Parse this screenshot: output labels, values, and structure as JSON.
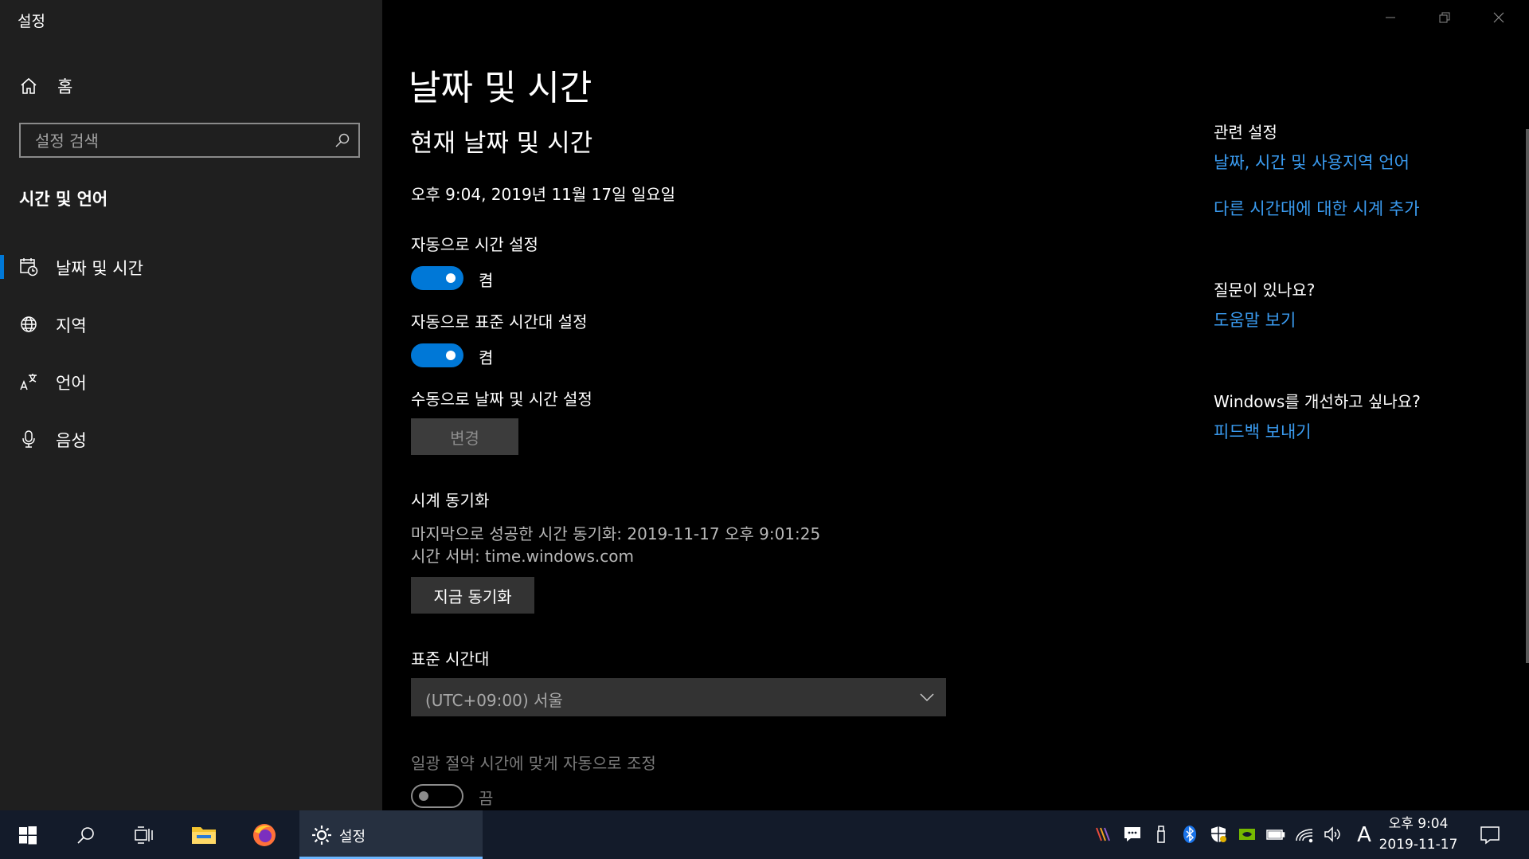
{
  "window": {
    "title": "설정"
  },
  "sidebar": {
    "home_label": "홈",
    "search_placeholder": "설정 검색",
    "section_header": "시간 및 언어",
    "items": [
      {
        "label": "날짜 및 시간",
        "icon": "calendar-clock-icon",
        "active": true
      },
      {
        "label": "지역",
        "icon": "globe-icon",
        "active": false
      },
      {
        "label": "언어",
        "icon": "language-icon",
        "active": false
      },
      {
        "label": "음성",
        "icon": "microphone-icon",
        "active": false
      }
    ]
  },
  "main": {
    "page_title": "날짜 및 시간",
    "current_header": "현재 날짜 및 시간",
    "current_datetime": "오후 9:04, 2019년 11월 17일 일요일",
    "auto_time": {
      "label": "자동으로 시간 설정",
      "state_label": "켬",
      "on": true
    },
    "auto_timezone": {
      "label": "자동으로 표준 시간대 설정",
      "state_label": "켬",
      "on": true
    },
    "manual": {
      "label": "수동으로 날짜 및 시간 설정",
      "button_label": "변경"
    },
    "sync": {
      "header": "시계 동기화",
      "last_sync": "마지막으로 성공한 시간 동기화: 2019-11-17 오후 9:01:25",
      "server": "시간 서버: time.windows.com",
      "button_label": "지금 동기화"
    },
    "timezone": {
      "label": "표준 시간대",
      "selected": "(UTC+09:00) 서울"
    },
    "dst": {
      "label": "일광 절약 시간에 맞게 자동으로 조정",
      "state_label": "끔",
      "on": false
    }
  },
  "related": {
    "header": "관련 설정",
    "links": [
      "날짜, 시간 및 사용지역 언어",
      "다른 시간대에 대한 시계 추가"
    ],
    "question_header": "질문이 있나요?",
    "help_link": "도움말 보기",
    "improve_header": "Windows를 개선하고 싶나요?",
    "feedback_link": "피드백 보내기"
  },
  "taskbar": {
    "active_app_label": "설정",
    "ime_indicator": "A",
    "clock_time": "오후 9:04",
    "clock_date": "2019-11-17"
  },
  "colors": {
    "accent": "#0078d7",
    "link": "#3a9bf0",
    "sidebar_bg": "#1f1f1f",
    "taskbar_bg": "#131b2a"
  }
}
